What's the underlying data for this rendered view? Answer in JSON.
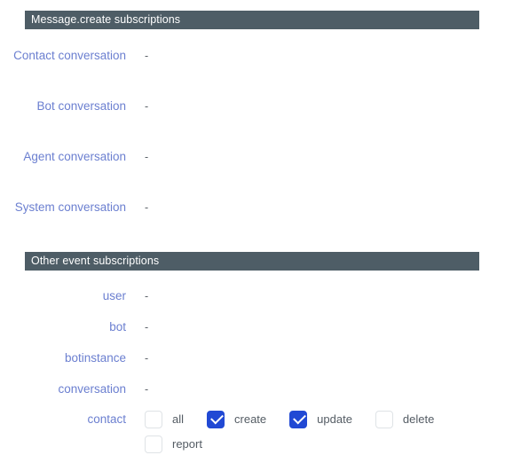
{
  "colors": {
    "section_header_bg": "#4e5d66",
    "section_header_text": "#ffffff",
    "label_blue": "#6b7fd0",
    "checkbox_checked_blue": "#2149d4",
    "checkbox_border": "#dfe3e6",
    "checkbox_label_text": "#545c64",
    "page_bg": "#ffffff"
  },
  "sections": [
    {
      "id": "message_create",
      "header": "Message.create subscriptions",
      "rows": [
        {
          "label": "Contact conversation",
          "value": "-"
        },
        {
          "label": "Bot conversation",
          "value": "-"
        },
        {
          "label": "Agent conversation",
          "value": "-"
        },
        {
          "label": "System conversation",
          "value": "-"
        }
      ]
    },
    {
      "id": "other_events",
      "header": "Other event subscriptions",
      "rows": [
        {
          "label": "user",
          "value": "-"
        },
        {
          "label": "bot",
          "value": "-"
        },
        {
          "label": "botinstance",
          "value": "-"
        },
        {
          "label": "conversation",
          "value": "-"
        }
      ],
      "checkbox_row": {
        "label": "contact",
        "lines": [
          [
            {
              "name": "all",
              "label": "all",
              "checked": false
            },
            {
              "name": "create",
              "label": "create",
              "checked": true
            },
            {
              "name": "update",
              "label": "update",
              "checked": true
            },
            {
              "name": "delete",
              "label": "delete",
              "checked": false
            }
          ],
          [
            {
              "name": "report",
              "label": "report",
              "checked": false
            }
          ]
        ]
      }
    }
  ]
}
